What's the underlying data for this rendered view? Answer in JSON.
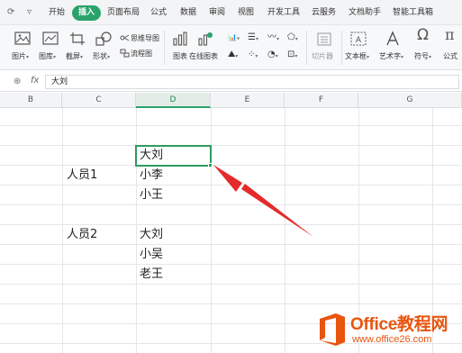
{
  "menubar": {
    "tabs": [
      {
        "label": "开始"
      },
      {
        "label": "插入"
      },
      {
        "label": "页面布局"
      },
      {
        "label": "公式"
      },
      {
        "label": "数据"
      },
      {
        "label": "审阅"
      },
      {
        "label": "视图"
      },
      {
        "label": "开发工具"
      },
      {
        "label": "云服务"
      },
      {
        "label": "文档助手"
      },
      {
        "label": "智能工具箱"
      }
    ],
    "active_tab": "插入",
    "active_color": "#2aa36b"
  },
  "ribbon": {
    "picture": "图片",
    "gallery": "图库",
    "screenshot": "截屏",
    "shapes": "形状",
    "mindmap": "思维导图",
    "flowchart": "流程图",
    "chart": "图表",
    "online_chart": "在线图表",
    "slicer": "切片器",
    "textbox": "文本框",
    "wordart": "艺术字",
    "symbol": "符号",
    "formula": "公式"
  },
  "formula_bar": {
    "fx": "fx",
    "value": "大刘"
  },
  "columns": [
    "B",
    "C",
    "D",
    "E",
    "F",
    "G"
  ],
  "selected_column": "D",
  "cells": {
    "d_row4": "大刘",
    "c_row5": "人员1",
    "d_row5": "小李",
    "d_row6": "小王",
    "c_row8": "人员2",
    "d_row8": "大刘",
    "d_row9": "小吴",
    "d_row10": "老王"
  },
  "arrow_color": "#e52a2a",
  "watermark": {
    "title": "Office教程网",
    "url": "www.office26.com",
    "brand_color": "#e8550f"
  }
}
